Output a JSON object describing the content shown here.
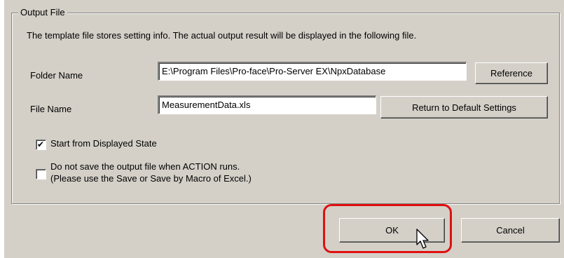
{
  "group": {
    "title": "Output File",
    "description": "The template file stores setting info. The actual output result will be displayed in the following file."
  },
  "folder": {
    "label": "Folder Name",
    "value": "E:\\Program Files\\Pro-face\\Pro-Server EX\\NpxDatabase",
    "button": "Reference"
  },
  "file": {
    "label": "File Name",
    "value": "MeasurementData.xls",
    "button": "Return to Default Settings"
  },
  "options": [
    {
      "label": "Start from Displayed State",
      "checked": true
    },
    {
      "label": "Do not save the output file when ACTION runs.",
      "label2": "(Please use the Save or Save by Macro of Excel.)",
      "checked": false
    }
  ],
  "buttons": {
    "ok": "OK",
    "cancel": "Cancel"
  },
  "colors": {
    "dialog_bg": "#d4d0c8",
    "highlight": "#e01010"
  },
  "icons": {
    "cursor": "mouse-pointer-icon",
    "check": "checkmark-icon"
  }
}
